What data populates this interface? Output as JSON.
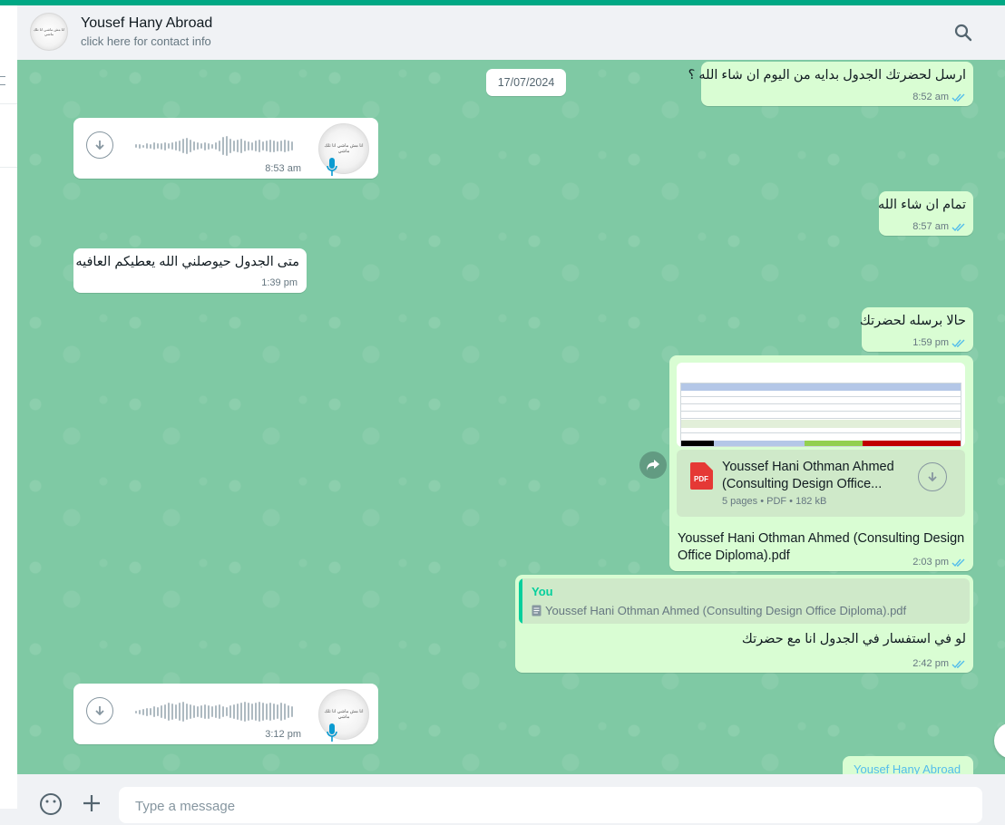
{
  "header": {
    "contact_name": "Yousef Hany Abroad",
    "contact_subtitle": "click here for contact info",
    "avatar_text": "انا مش ماشي انا تلك ماشي",
    "search_icon": "search-icon"
  },
  "chat": {
    "date_chip": "17/07/2024",
    "messages": [
      {
        "text": "ارسل لحضرتك الجدول بدايه من اليوم ان شاء الله ؟",
        "time": "8:52 am"
      },
      {
        "time": "8:53 am"
      },
      {
        "text": "تمام ان شاء الله",
        "time": "8:57 am"
      },
      {
        "text": "متى الجدول حيوصلني الله يعطيكم العافيه",
        "time": "1:39 pm"
      },
      {
        "text": "حالا برسله لحضرتك",
        "time": "1:59 pm"
      },
      {
        "doc_name": "Youssef Hani Othman Ahmed (Consulting Design Office...",
        "doc_info": "5 pages • PDF • 182 kB",
        "pdf_badge": "PDF",
        "caption": "Youssef Hani Othman Ahmed (Consulting Design Office Diploma).pdf",
        "time": "2:03 pm"
      },
      {
        "quote_author": "You",
        "quote_doc": "Youssef Hani Othman Ahmed (Consulting Design Office Diploma).pdf",
        "text": "لو في استفسار في الجدول انا مع حضرتك",
        "time": "2:42 pm"
      },
      {
        "time": "3:12 pm"
      },
      {
        "partial_author": "Yousef Hany Abroad"
      }
    ]
  },
  "composer": {
    "placeholder": "Type a message"
  },
  "colors": {
    "accent": "#00a884",
    "outgoing_bubble": "#d9fdd3",
    "incoming_bubble": "#ffffff",
    "chat_background": "#7fc9a4",
    "read_ticks": "#53bdeb"
  }
}
